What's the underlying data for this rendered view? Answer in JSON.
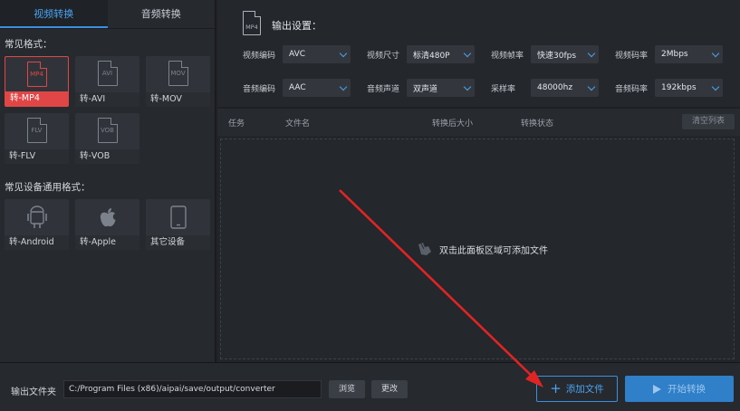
{
  "left_tabs": [
    "视频转换",
    "音频转换"
  ],
  "common_formats": {
    "title": "常见格式：",
    "items": [
      {
        "icon": "MP4",
        "label": "转-MP4",
        "active": true
      },
      {
        "icon": "AVI",
        "label": "转-AVI"
      },
      {
        "icon": "MOV",
        "label": "转-MOV"
      },
      {
        "icon": "FLV",
        "label": "转-FLV"
      },
      {
        "icon": "VOB",
        "label": "转-VOB"
      }
    ]
  },
  "device_formats": {
    "title": "常见设备通用格式：",
    "items": [
      {
        "icon": "android-icon",
        "label": "转-Android"
      },
      {
        "icon": "apple-icon",
        "label": "转-Apple"
      },
      {
        "icon": "tablet-icon",
        "label": "其它设备"
      }
    ]
  },
  "output_settings": {
    "icon_text": "MP4",
    "title": "输出设置：",
    "row1": [
      {
        "label": "视频编码",
        "value": "AVC"
      },
      {
        "label": "视频尺寸",
        "value": "标清480P"
      },
      {
        "label": "视频帧率",
        "value": "快速30fps"
      },
      {
        "label": "视频码率",
        "value": "2Mbps"
      }
    ],
    "row2": [
      {
        "label": "音频编码",
        "value": "AAC"
      },
      {
        "label": "音频声道",
        "value": "双声道"
      },
      {
        "label": "采样率",
        "value": "48000hz"
      },
      {
        "label": "音频码率",
        "value": "192kbps"
      }
    ]
  },
  "table": {
    "headers": [
      "任务",
      "文件名",
      "转换后大小",
      "转换状态"
    ],
    "clear_label": "清空列表",
    "drop_hint": "双击此面板区域可添加文件"
  },
  "bottom": {
    "output_label": "输出文件夹",
    "output_path": "C:/Program Files (x86)/aipai/save/output/converter",
    "browse_label": "浏览",
    "change_label": "更改",
    "add_label": "添加文件",
    "start_label": "开始转换"
  },
  "colors": {
    "accent": "#3b8fe0",
    "active_red": "#e04646",
    "annotation_arrow": "#e02424"
  }
}
